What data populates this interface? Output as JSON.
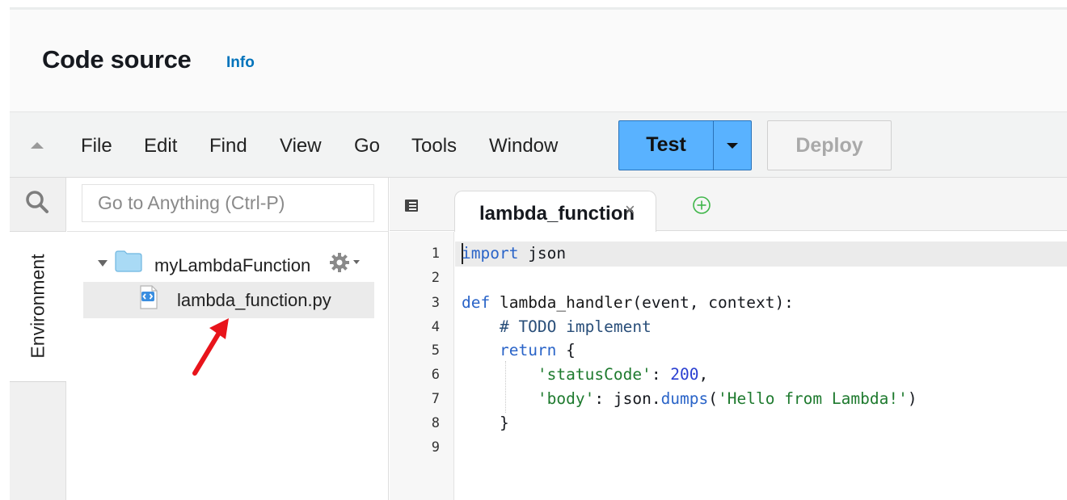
{
  "section": {
    "title": "Code source",
    "info_link": "Info"
  },
  "menu": {
    "items": [
      "File",
      "Edit",
      "Find",
      "View",
      "Go",
      "Tools",
      "Window"
    ],
    "test_label": "Test",
    "deploy_label": "Deploy"
  },
  "sidebar": {
    "rail_tab": "Environment",
    "search_placeholder": "Go to Anything (Ctrl-P)",
    "folder_name": "myLambdaFunction",
    "file_name": "lambda_function.py"
  },
  "editor": {
    "active_tab": "lambda_function",
    "close_glyph": "×",
    "line_numbers": [
      "1",
      "2",
      "3",
      "4",
      "5",
      "6",
      "7",
      "8",
      "9"
    ],
    "code": {
      "l1_kw": "import",
      "l1_rest": " json",
      "l3_kw": "def",
      "l3_name": " lambda_handler",
      "l3_rest": "(event, context):",
      "l4_comment": "    # TODO implement",
      "l5_indent": "    ",
      "l5_kw": "return",
      "l5_rest": " {",
      "l6_indent": "        ",
      "l6_key": "'statusCode'",
      "l6_sep": ": ",
      "l6_num": "200",
      "l6_end": ",",
      "l7_indent": "        ",
      "l7_key": "'body'",
      "l7_mid": ": json.",
      "l7_fn": "dumps",
      "l7_paren": "(",
      "l7_str": "'Hello from Lambda!'",
      "l7_end": ")",
      "l8": "    }"
    }
  },
  "colors": {
    "test_button": "#59b2ff",
    "info_link": "#0073bb",
    "keyword": "#2a64c8",
    "string": "#1e7a2e",
    "number": "#2a3fd1",
    "annotation_arrow": "#e8141b"
  },
  "icons": [
    "collapse-icon",
    "search-icon",
    "folder-icon",
    "gear-icon",
    "python-file-icon",
    "tabs-menu-icon",
    "close-icon",
    "add-tab-icon",
    "red-arrow-annotation"
  ]
}
